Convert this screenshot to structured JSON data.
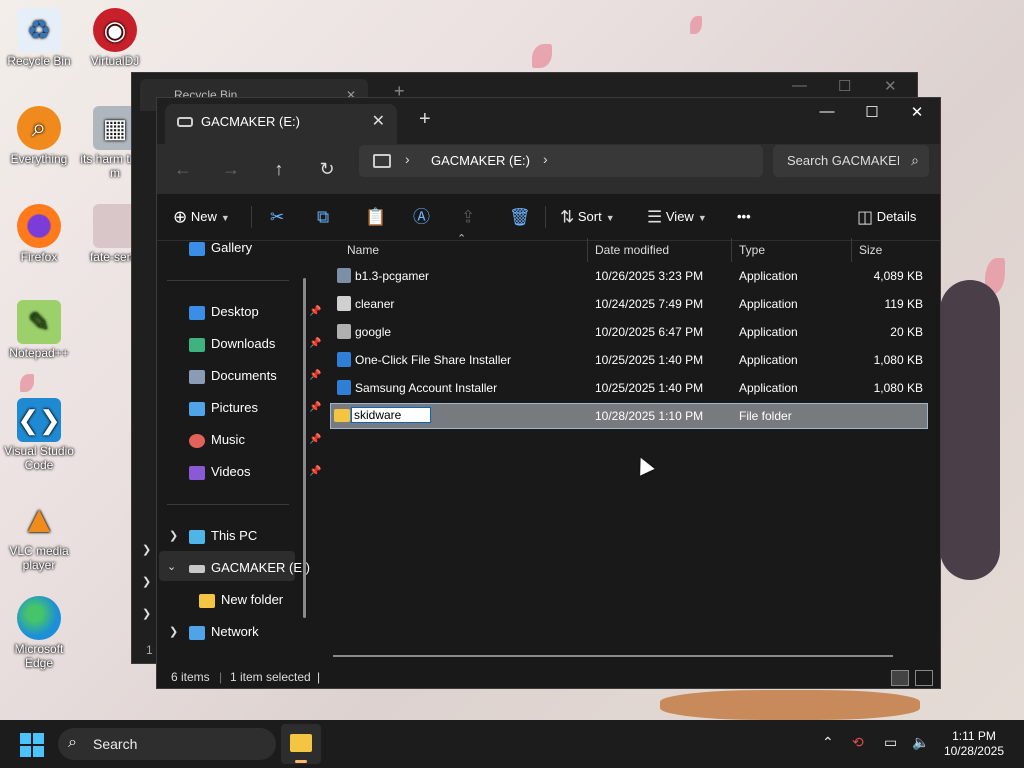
{
  "desktop": {
    "icons": [
      {
        "label": "Recycle Bin",
        "icon": "recycle-bin-icon"
      },
      {
        "label": "VirtualDJ",
        "icon": "virtualdj-icon"
      },
      {
        "label": "Everything",
        "icon": "everything-search-icon"
      },
      {
        "label": "its harm trust m",
        "icon": "application-icon"
      },
      {
        "label": "Firefox",
        "icon": "firefox-icon"
      },
      {
        "label": "fate-sene",
        "icon": "image-icon"
      },
      {
        "label": "Notepad++",
        "icon": "notepadpp-icon"
      },
      {
        "label": "Visual Studio Code",
        "icon": "vscode-icon"
      },
      {
        "label": "VLC media player",
        "icon": "vlc-icon"
      },
      {
        "label": "Microsoft Edge",
        "icon": "edge-icon"
      }
    ]
  },
  "background_window": {
    "tab_title": "Recycle Bin",
    "status_fragment": "1 i"
  },
  "explorer": {
    "tab_title": "GACMAKER (E:)",
    "breadcrumb": "GACMAKER (E:)",
    "search_placeholder": "Search GACMAKER (E:)",
    "toolbar": {
      "new_label": "New",
      "sort_label": "Sort",
      "view_label": "View",
      "more_label": "•••",
      "details_label": "Details"
    },
    "nav": {
      "gallery": "Gallery",
      "quick_access": [
        {
          "label": "Desktop",
          "color": "#3a8ee6"
        },
        {
          "label": "Downloads",
          "color": "#3fb27f"
        },
        {
          "label": "Documents",
          "color": "#8a9bb5"
        },
        {
          "label": "Pictures",
          "color": "#4fa3e6"
        },
        {
          "label": "Music",
          "color": "#e2625a"
        },
        {
          "label": "Videos",
          "color": "#8a5ad6"
        }
      ],
      "this_pc": "This PC",
      "drive": "GACMAKER (E:)",
      "new_folder": "New folder",
      "network": "Network"
    },
    "columns": {
      "name": "Name",
      "date": "Date modified",
      "type": "Type",
      "size": "Size"
    },
    "files": [
      {
        "name": "b1.3-pcgamer",
        "date": "10/26/2025 3:23 PM",
        "type": "Application",
        "size": "4,089 KB",
        "icon_color": "#7a8fa8"
      },
      {
        "name": "cleaner",
        "date": "10/24/2025 7:49 PM",
        "type": "Application",
        "size": "119 KB",
        "icon_color": "#d0d0d0"
      },
      {
        "name": "google",
        "date": "10/20/2025 6:47 PM",
        "type": "Application",
        "size": "20 KB",
        "icon_color": "#b0b0b0"
      },
      {
        "name": "One-Click File Share Installer",
        "date": "10/25/2025 1:40 PM",
        "type": "Application",
        "size": "1,080 KB",
        "icon_color": "#2f7fd6"
      },
      {
        "name": "Samsung Account Installer",
        "date": "10/25/2025 1:40 PM",
        "type": "Application",
        "size": "1,080 KB",
        "icon_color": "#2f7fd6"
      }
    ],
    "selected_folder": {
      "name": "skidware",
      "date": "10/28/2025 1:10 PM",
      "type": "File folder",
      "size": ""
    },
    "status": {
      "items": "6 items",
      "selected": "1 item selected",
      "bar": "|"
    }
  },
  "taskbar": {
    "search_label": "Search",
    "time": "1:11 PM",
    "date": "10/28/2025"
  }
}
